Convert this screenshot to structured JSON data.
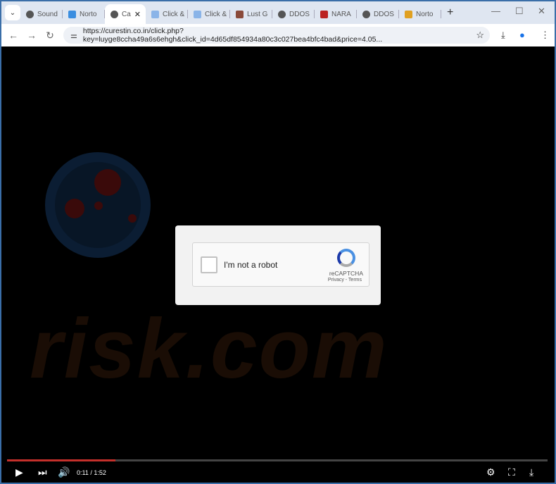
{
  "tabs": [
    {
      "label": "Sound",
      "icon": "globe-icon"
    },
    {
      "label": "Norto",
      "icon": "norton-icon"
    },
    {
      "label": "Ca",
      "icon": "globe-icon",
      "active": true
    },
    {
      "label": "Click &",
      "icon": "house-icon"
    },
    {
      "label": "Click &",
      "icon": "house-icon"
    },
    {
      "label": "Lust G",
      "icon": "avatar-icon"
    },
    {
      "label": "DDOS",
      "icon": "globe-icon"
    },
    {
      "label": "NARA",
      "icon": "red-square-icon"
    },
    {
      "label": "DDOS",
      "icon": "globe-icon"
    },
    {
      "label": "Norto",
      "icon": "bars-icon"
    }
  ],
  "address": {
    "url": "https://curestin.co.in/click.php?key=luyge8ccha49a6s6ehgh&click_id=4d65df854934a80c3c027bea4bfc4bad&price=4.05..."
  },
  "watermark": {
    "text": "risk.com"
  },
  "captcha": {
    "label": "I'm not a robot",
    "brand": "reCAPTCHA",
    "links": "Privacy - Terms"
  },
  "video": {
    "time": "0:11 / 1:52",
    "progress_fraction": 0.2,
    "progress_color": "#c4302b"
  },
  "colors": {
    "frame": "#3a6ea8",
    "accent": "#4a90e2"
  }
}
